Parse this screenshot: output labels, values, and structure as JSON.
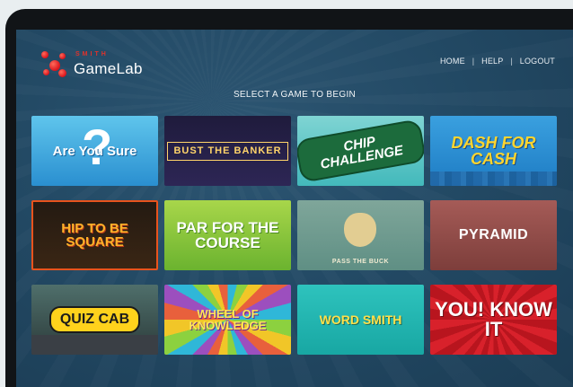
{
  "brand": {
    "small": "SMITH",
    "name": "GameLab"
  },
  "nav": {
    "home": "HOME",
    "help": "HELP",
    "logout": "LOGOUT",
    "separator": "|"
  },
  "prompt": "SELECT A GAME TO BEGIN",
  "games": [
    {
      "title": "Are You Sure"
    },
    {
      "title": "BUST THE BANKER"
    },
    {
      "title": "CHIP CHALLENGE"
    },
    {
      "title": "DASH FOR CASH"
    },
    {
      "title": "HIP TO BE SQUARE"
    },
    {
      "title": "PAR FOR THE COURSE"
    },
    {
      "title": "PASS THE BUCK"
    },
    {
      "title": "PYRAMID"
    },
    {
      "title": "QUIZ CAB"
    },
    {
      "title": "WHEEL OF KNOWLEDGE"
    },
    {
      "title": "WORD SMITH"
    },
    {
      "title": "YOU! KNOW IT"
    }
  ]
}
